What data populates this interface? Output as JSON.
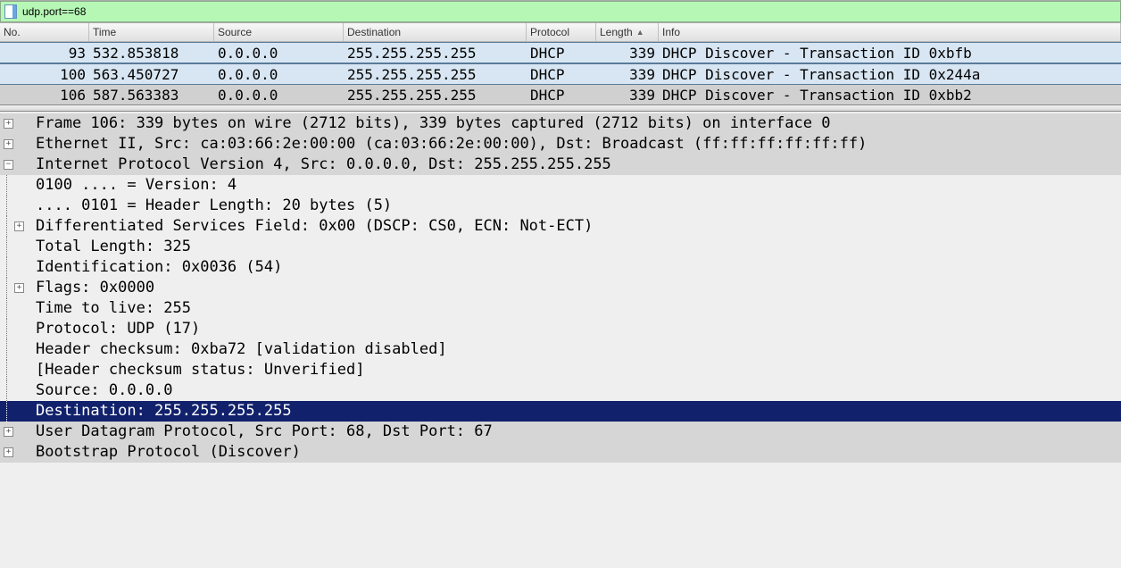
{
  "filter": {
    "text": "udp.port==68"
  },
  "columns": {
    "no": "No.",
    "time": "Time",
    "source": "Source",
    "destination": "Destination",
    "protocol": "Protocol",
    "length": "Length",
    "info": "Info"
  },
  "packets": [
    {
      "no": "93",
      "time": "532.853818",
      "src": "0.0.0.0",
      "dst": "255.255.255.255",
      "proto": "DHCP",
      "len": "339",
      "info": "DHCP Discover - Transaction ID 0xbfb",
      "sel": true
    },
    {
      "no": "100",
      "time": "563.450727",
      "src": "0.0.0.0",
      "dst": "255.255.255.255",
      "proto": "DHCP",
      "len": "339",
      "info": "DHCP Discover - Transaction ID 0x244a",
      "sel": true
    },
    {
      "no": "106",
      "time": "587.563383",
      "src": "0.0.0.0",
      "dst": "255.255.255.255",
      "proto": "DHCP",
      "len": "339",
      "info": "DHCP Discover - Transaction ID 0xbb2",
      "gray": true
    }
  ],
  "detail": {
    "frame": "Frame 106: 339 bytes on wire (2712 bits), 339 bytes captured (2712 bits) on interface 0",
    "eth": "Ethernet II, Src: ca:03:66:2e:00:00 (ca:03:66:2e:00:00), Dst: Broadcast (ff:ff:ff:ff:ff:ff)",
    "ip": "Internet Protocol Version 4, Src: 0.0.0.0, Dst: 255.255.255.255",
    "ip_ver": "0100 .... = Version: 4",
    "ip_hlen": ".... 0101 = Header Length: 20 bytes (5)",
    "ip_dscp": "Differentiated Services Field: 0x00 (DSCP: CS0, ECN: Not-ECT)",
    "ip_tlen": "Total Length: 325",
    "ip_id": "Identification: 0x0036 (54)",
    "ip_flags": "Flags: 0x0000",
    "ip_ttl": "Time to live: 255",
    "ip_proto": "Protocol: UDP (17)",
    "ip_chk": "Header checksum: 0xba72 [validation disabled]",
    "ip_chks": "[Header checksum status: Unverified]",
    "ip_src": "Source: 0.0.0.0",
    "ip_dst": "Destination: 255.255.255.255",
    "udp": "User Datagram Protocol, Src Port: 68, Dst Port: 67",
    "bootp": "Bootstrap Protocol (Discover)"
  }
}
